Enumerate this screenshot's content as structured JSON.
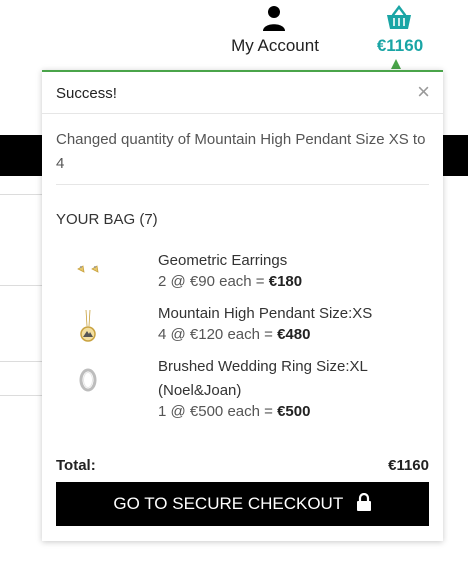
{
  "header": {
    "account_label": "My Account",
    "basket_total": "€1160",
    "accent_color": "#1aa5a5"
  },
  "popup": {
    "title": "Success!",
    "close_symbol": "×",
    "message": "Changed quantity of Mountain High Pendant Size XS to 4",
    "bag_title": "YOUR BAG (7)",
    "items": [
      {
        "name": "Geometric Earrings",
        "qty_text": "2 @ €90 each = ",
        "line_total": "€180",
        "icon": "earrings-icon"
      },
      {
        "name": "Mountain High Pendant Size:XS",
        "qty_text": "4 @ €120 each = ",
        "line_total": "€480",
        "icon": "pendant-icon"
      },
      {
        "name": "Brushed Wedding Ring Size:XL (Noel&Joan)",
        "qty_text": "1 @ €500 each = ",
        "line_total": "€500",
        "icon": "ring-icon"
      }
    ],
    "total_label": "Total:",
    "total_value": "€1160",
    "checkout_label": "GO TO SECURE CHECKOUT",
    "success_color": "#4aa44a"
  }
}
